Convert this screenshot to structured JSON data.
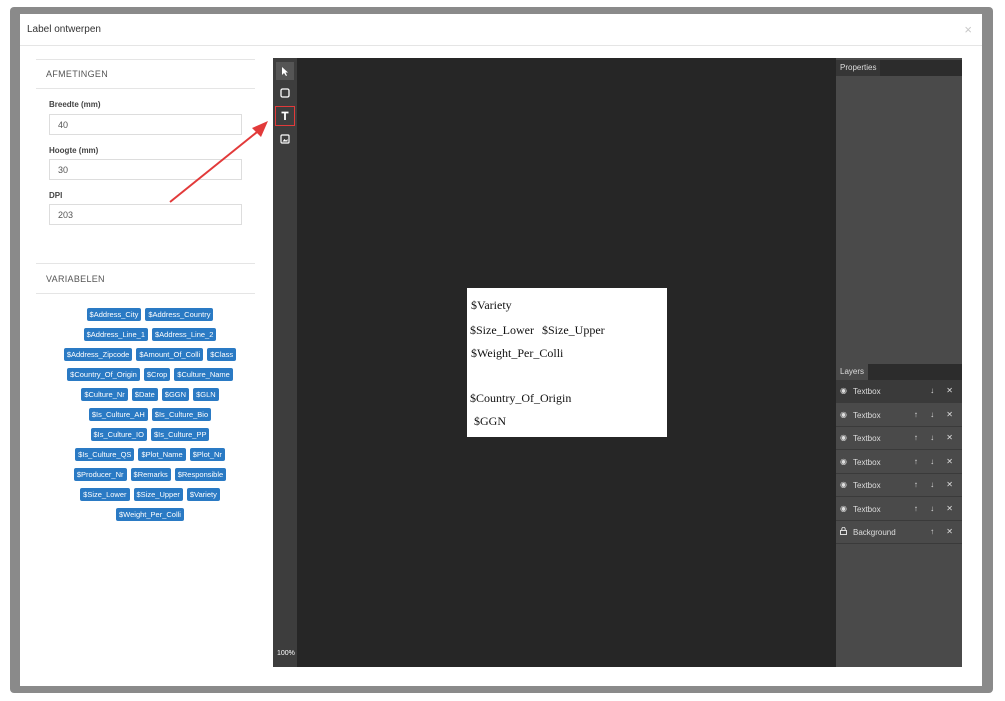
{
  "dialog": {
    "title": "Label ontwerpen",
    "close_glyph": "×"
  },
  "afmetingen": {
    "heading": "AFMETINGEN",
    "width_label": "Breedte (mm)",
    "width_value": "40",
    "height_label": "Hoogte (mm)",
    "height_value": "30",
    "dpi_label": "DPI",
    "dpi_value": "203"
  },
  "variabelen": {
    "heading": "VARIABELEN",
    "tags": [
      "$Address_City",
      "$Address_Country",
      "$Address_Line_1",
      "$Address_Line_2",
      "$Address_Zipcode",
      "$Amount_Of_Colli",
      "$Class",
      "$Country_Of_Origin",
      "$Crop",
      "$Culture_Name",
      "$Culture_Nr",
      "$Date",
      "$GGN",
      "$GLN",
      "$Is_Culture_AH",
      "$Is_Culture_Bio",
      "$Is_Culture_IO",
      "$Is_Culture_PP",
      "$Is_Culture_QS",
      "$Plot_Name",
      "$Plot_Nr",
      "$Producer_Nr",
      "$Remarks",
      "$Responsible",
      "$Size_Lower",
      "$Size_Upper",
      "$Variety",
      "$Weight_Per_Colli"
    ]
  },
  "toolbar": {
    "tools": [
      "select-pointer-icon",
      "rectangle-icon",
      "text-icon",
      "image-icon"
    ],
    "zoom": "100%"
  },
  "canvas": {
    "lines": [
      "$Variety",
      "$Size_Lower",
      "$Size_Upper",
      "$Weight_Per_Colli",
      "$Country_Of_Origin",
      "$GGN"
    ]
  },
  "properties": {
    "tab_label": "Properties"
  },
  "layers": {
    "tab_label": "Layers",
    "items": [
      {
        "name": "Textbox",
        "icon": "eye-icon",
        "controls": "↓ ✕"
      },
      {
        "name": "Textbox",
        "icon": "eye-icon",
        "controls": "↑ ↓ ✕"
      },
      {
        "name": "Textbox",
        "icon": "eye-icon",
        "controls": "↑ ↓ ✕"
      },
      {
        "name": "Textbox",
        "icon": "eye-icon",
        "controls": "↑ ↓ ✕"
      },
      {
        "name": "Textbox",
        "icon": "eye-icon",
        "controls": "↑ ↓ ✕"
      },
      {
        "name": "Textbox",
        "icon": "eye-icon",
        "controls": "↑ ↓ ✕"
      },
      {
        "name": "Background",
        "icon": "lock-icon",
        "controls": "↑ ✕"
      }
    ]
  },
  "annotation": {
    "color": "#e23a3a"
  }
}
